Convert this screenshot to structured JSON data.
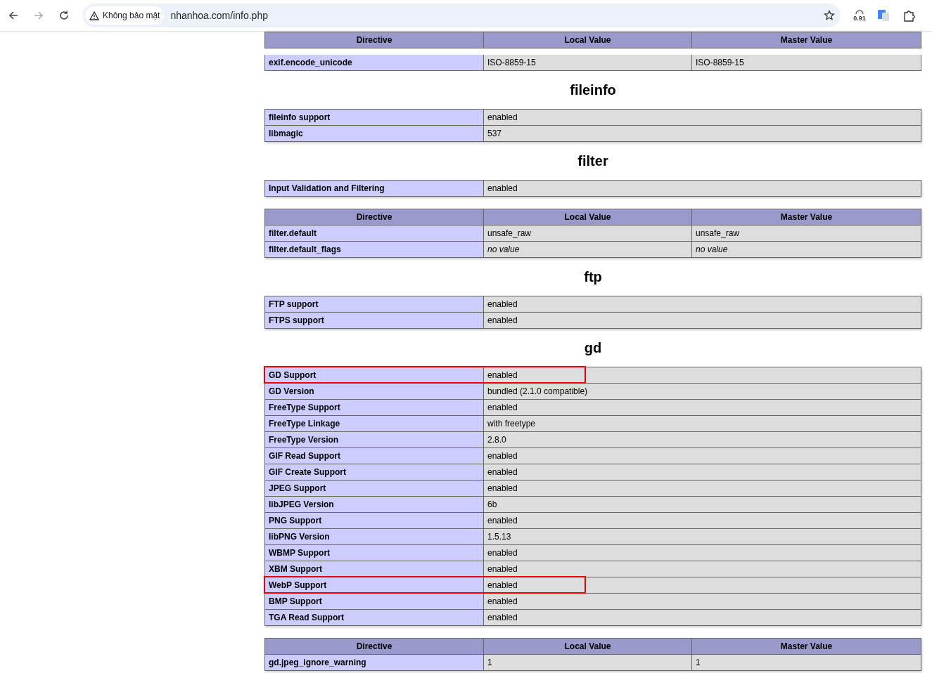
{
  "browser": {
    "security_label": "Không bảo mật",
    "url": "nhanhoa.com/info.php",
    "badge": "0.91"
  },
  "top_table": {
    "columns": [
      "Directive",
      "Local Value",
      "Master Value"
    ],
    "rows": [
      {
        "cells": [
          "exif.encode_unicode",
          "ISO-8859-15",
          "ISO-8859-15"
        ],
        "no_value": [
          false,
          false
        ]
      }
    ]
  },
  "sections": [
    {
      "title": "fileinfo",
      "tables": [
        {
          "kind": "info",
          "rows": [
            {
              "cells": [
                "fileinfo support",
                "enabled"
              ],
              "highlighted": false
            },
            {
              "cells": [
                "libmagic",
                "537"
              ],
              "highlighted": false
            }
          ]
        }
      ]
    },
    {
      "title": "filter",
      "tables": [
        {
          "kind": "info",
          "rows": [
            {
              "cells": [
                "Input Validation and Filtering",
                "enabled"
              ],
              "highlighted": false
            }
          ]
        },
        {
          "kind": "directive",
          "columns": [
            "Directive",
            "Local Value",
            "Master Value"
          ],
          "rows": [
            {
              "cells": [
                "filter.default",
                "unsafe_raw",
                "unsafe_raw"
              ],
              "no_value": [
                false,
                false
              ]
            },
            {
              "cells": [
                "filter.default_flags",
                "no value",
                "no value"
              ],
              "no_value": [
                true,
                true
              ]
            }
          ]
        }
      ]
    },
    {
      "title": "ftp",
      "tables": [
        {
          "kind": "info",
          "rows": [
            {
              "cells": [
                "FTP support",
                "enabled"
              ],
              "highlighted": false
            },
            {
              "cells": [
                "FTPS support",
                "enabled"
              ],
              "highlighted": false
            }
          ]
        }
      ]
    },
    {
      "title": "gd",
      "tables": [
        {
          "kind": "info",
          "rows": [
            {
              "cells": [
                "GD Support",
                "enabled"
              ],
              "highlighted": true
            },
            {
              "cells": [
                "GD Version",
                "bundled (2.1.0 compatible)"
              ],
              "highlighted": false
            },
            {
              "cells": [
                "FreeType Support",
                "enabled"
              ],
              "highlighted": false
            },
            {
              "cells": [
                "FreeType Linkage",
                "with freetype"
              ],
              "highlighted": false
            },
            {
              "cells": [
                "FreeType Version",
                "2.8.0"
              ],
              "highlighted": false
            },
            {
              "cells": [
                "GIF Read Support",
                "enabled"
              ],
              "highlighted": false
            },
            {
              "cells": [
                "GIF Create Support",
                "enabled"
              ],
              "highlighted": false
            },
            {
              "cells": [
                "JPEG Support",
                "enabled"
              ],
              "highlighted": false
            },
            {
              "cells": [
                "libJPEG Version",
                "6b"
              ],
              "highlighted": false
            },
            {
              "cells": [
                "PNG Support",
                "enabled"
              ],
              "highlighted": false
            },
            {
              "cells": [
                "libPNG Version",
                "1.5.13"
              ],
              "highlighted": false
            },
            {
              "cells": [
                "WBMP Support",
                "enabled"
              ],
              "highlighted": false
            },
            {
              "cells": [
                "XBM Support",
                "enabled"
              ],
              "highlighted": false
            },
            {
              "cells": [
                "WebP Support",
                "enabled"
              ],
              "highlighted": true
            },
            {
              "cells": [
                "BMP Support",
                "enabled"
              ],
              "highlighted": false
            },
            {
              "cells": [
                "TGA Read Support",
                "enabled"
              ],
              "highlighted": false
            }
          ]
        },
        {
          "kind": "directive",
          "columns": [
            "Directive",
            "Local Value",
            "Master Value"
          ],
          "rows": [
            {
              "cells": [
                "gd.jpeg_ignore_warning",
                "1",
                "1"
              ],
              "no_value": [
                false,
                false
              ]
            }
          ]
        }
      ]
    }
  ]
}
